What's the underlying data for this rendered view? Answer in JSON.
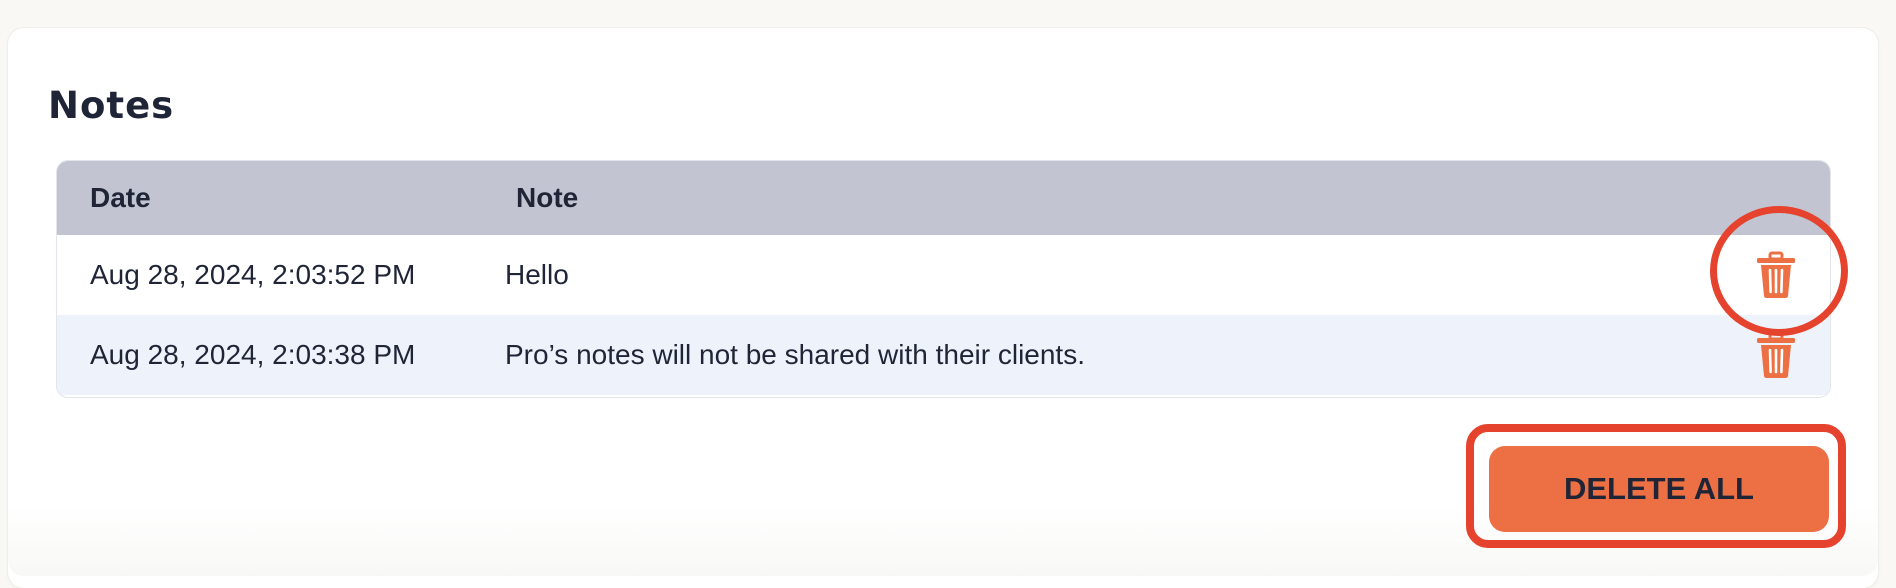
{
  "notes": {
    "title": "Notes",
    "columns": {
      "date": "Date",
      "note": "Note"
    },
    "rows": [
      {
        "date": "Aug 28, 2024, 2:03:52 PM",
        "note": "Hello"
      },
      {
        "date": "Aug 28, 2024, 2:03:38 PM",
        "note": "Pro’s notes will not be shared with their clients."
      }
    ],
    "delete_icon": "trash-icon",
    "delete_all_label": "DELETE ALL"
  },
  "colors": {
    "accent": "#ec7043",
    "highlight_outline": "#e5432d",
    "header_bg": "#c2c5d1",
    "alt_row_bg": "#eef2fa",
    "text": "#1f2537"
  }
}
